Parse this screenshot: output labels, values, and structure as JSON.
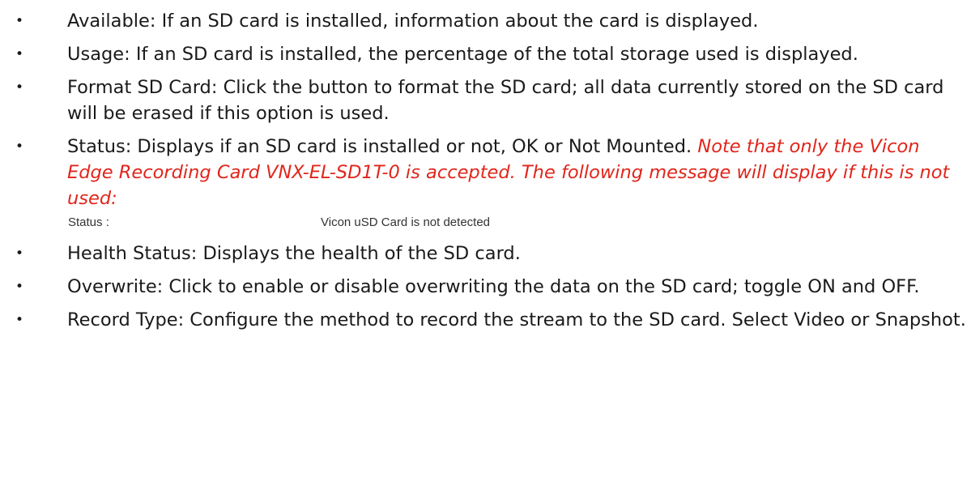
{
  "bullet_glyph": "•",
  "items": [
    {
      "text": "Available: If an SD card is installed, information about the card is displayed."
    },
    {
      "text": "Usage: If an SD card is installed, the percentage of the total storage used is displayed."
    },
    {
      "text": "Format SD Card: Click the button to format the SD card; all data currently stored on the SD card will be erased if this option is used."
    },
    {
      "text": "Status: Displays if an SD card is installed or not, OK or Not Mounted. ",
      "note": "Note that only the Vicon Edge Recording Card VNX-EL-SD1T-0 is accepted. The following message will display if this is not used:"
    },
    {
      "text": "Health Status: Displays the health of the SD card."
    },
    {
      "text": "Overwrite: Click to enable or disable overwriting the data on the SD card; toggle ON and OFF."
    },
    {
      "text": "Record Type: Configure the method to record the stream to the SD card. Select Video or Snapshot."
    }
  ],
  "status_screenshot": {
    "label": "Status :",
    "value": "Vicon uSD Card is not detected"
  },
  "colors": {
    "note": "#e1251b",
    "text": "#1a1a1a"
  }
}
